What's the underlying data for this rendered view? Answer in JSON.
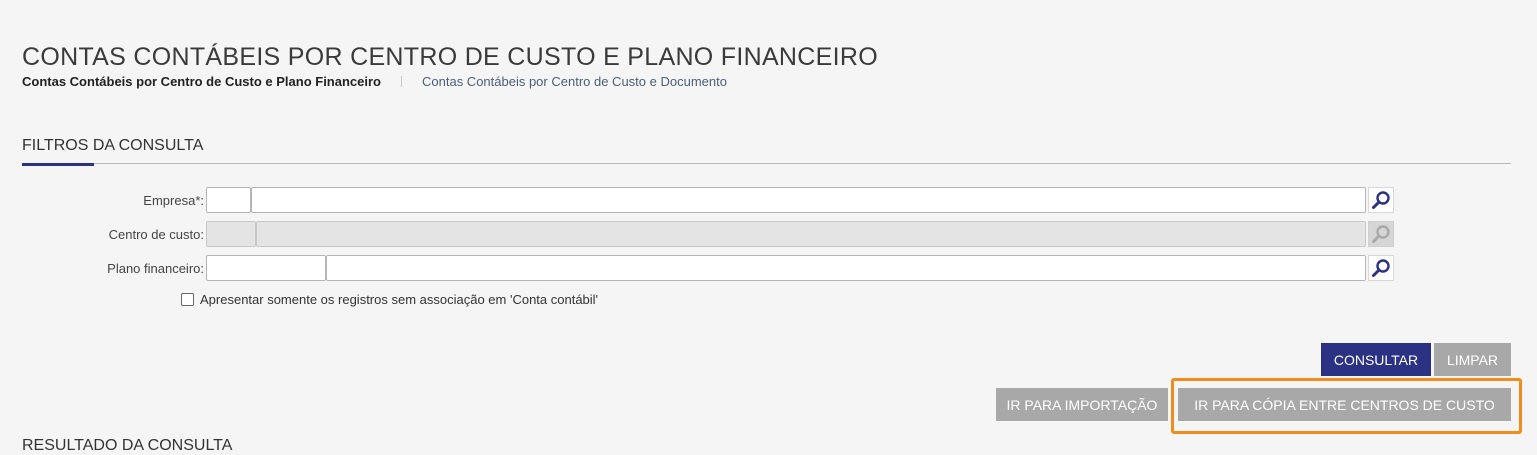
{
  "page": {
    "title": "CONTAS CONTÁBEIS POR CENTRO DE CUSTO E PLANO FINANCEIRO"
  },
  "breadcrumb": {
    "active": "Contas Contábeis por Centro de Custo e Plano Financeiro",
    "link": "Contas Contábeis por Centro de Custo e Documento"
  },
  "filters": {
    "title": "FILTROS DA CONSULTA",
    "empresa": {
      "label": "Empresa*:",
      "code": "",
      "name": ""
    },
    "centro_custo": {
      "label": "Centro de custo:",
      "code": "",
      "name": "",
      "disabled": true
    },
    "plano_financeiro": {
      "label": "Plano financeiro:",
      "code": "",
      "name": ""
    },
    "checkbox": {
      "label": "Apresentar somente os registros sem associação em 'Conta contábil'",
      "checked": false
    }
  },
  "buttons": {
    "consultar": "CONSULTAR",
    "limpar": "LIMPAR",
    "importacao": "IR PARA IMPORTAÇÃO",
    "copia": "IR PARA CÓPIA ENTRE CENTROS DE CUSTO"
  },
  "results": {
    "title": "RESULTADO DA CONSULTA"
  },
  "colors": {
    "primary": "#2b3283",
    "button_gray": "#a8a8a8",
    "highlight": "#f28c1a",
    "background": "#f5f5f5"
  },
  "icons": {
    "lookup": "magnifier-icon"
  }
}
